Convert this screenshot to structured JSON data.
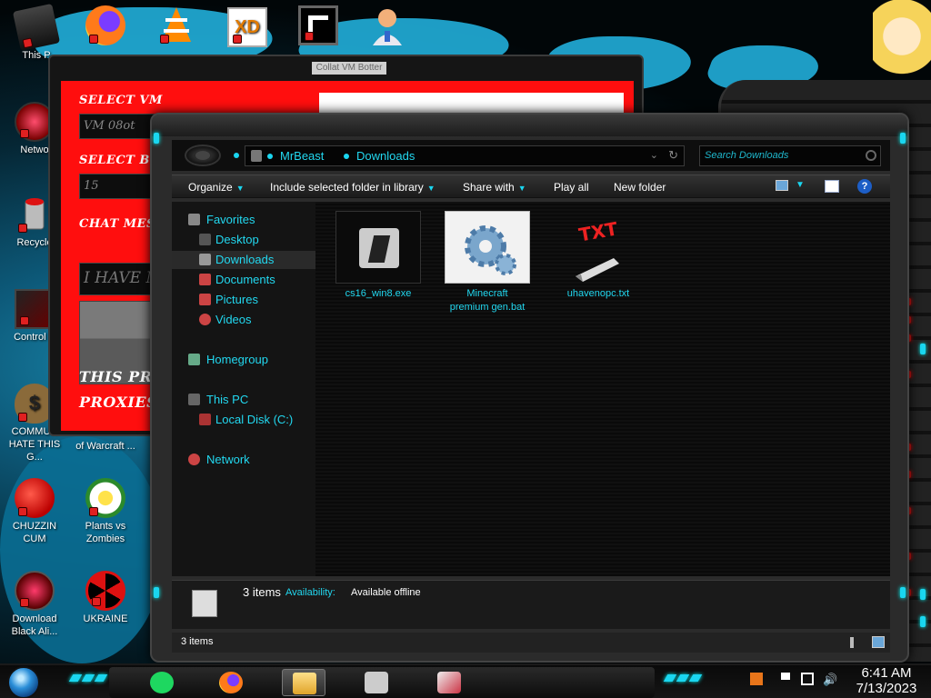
{
  "desktop": {
    "icons": [
      {
        "label": "This PC",
        "visible": "This P"
      },
      {
        "label": "Network",
        "visible": "Netwo"
      },
      {
        "label": "Recycle",
        "visible": "Recycle"
      },
      {
        "label": "Control Panel",
        "visible": "Control P"
      },
      {
        "label": "COMMUNIST HATE THIS G...",
        "line1": "COMMUN",
        "line2": "HATE THIS G..."
      },
      {
        "label": "of Warcraft ...",
        "visible": "of Warcraft ..."
      },
      {
        "label": "CHUZZIN CUM",
        "line1": "CHUZZIN",
        "line2": "CUM"
      },
      {
        "label": "Plants vs Zombies",
        "line1": "Plants vs",
        "line2": "Zombies"
      },
      {
        "label": "Download Black Ali...",
        "line1": "Download",
        "line2": "Black Ali..."
      },
      {
        "label": "UKRAINE",
        "visible": "UKRAINE"
      }
    ],
    "top_icons": [
      "firefox-icon",
      "vlc-icon",
      "xd-icon",
      "game-icon",
      "user-icon"
    ]
  },
  "bot_window": {
    "title": "Collat VM Botter",
    "select_vm_label": "SELECT VM",
    "select_vm_value": "VM 08ot",
    "select_bot_label": "SELECT BOT",
    "select_bot_value": "15",
    "chat_label": "CHAT MESSAGE",
    "chat_value": "I HAVE MO",
    "footer_line1": "THIS PROG",
    "footer_line2": "PROXIES L"
  },
  "explorer": {
    "breadcrumb": [
      "MrBeast",
      "Downloads"
    ],
    "search_placeholder": "Search Downloads",
    "commands": [
      "Organize",
      "Include selected folder in library",
      "Share with",
      "Play all",
      "New folder"
    ],
    "nav": {
      "favorites": "Favorites",
      "desktop": "Desktop",
      "downloads": "Downloads",
      "documents": "Documents",
      "pictures": "Pictures",
      "videos": "Videos",
      "homegroup": "Homegroup",
      "this_pc": "This PC",
      "local_disk": "Local Disk (C:)",
      "network": "Network"
    },
    "files": [
      {
        "name": "cs16_win8.exe",
        "icon": "counter-strike-icon"
      },
      {
        "name_line1": "Minecraft",
        "name_line2": "premium gen.bat",
        "icon": "gears-icon"
      },
      {
        "name": "uhavenopc.txt",
        "icon": "txt-icon"
      }
    ],
    "details": {
      "count": "3 items",
      "availability_label": "Availability:",
      "availability_value": "Available offline"
    },
    "status_text": "3 items"
  },
  "taskbar": {
    "time": "6:41 AM",
    "date": "7/13/2023",
    "apps": [
      "spotify-icon",
      "firefox-icon",
      "file-explorer-icon",
      "counter-strike-icon",
      "monitor-icon"
    ]
  },
  "colors": {
    "accent": "#22d8f0",
    "bot_red": "#ff0e0e"
  }
}
